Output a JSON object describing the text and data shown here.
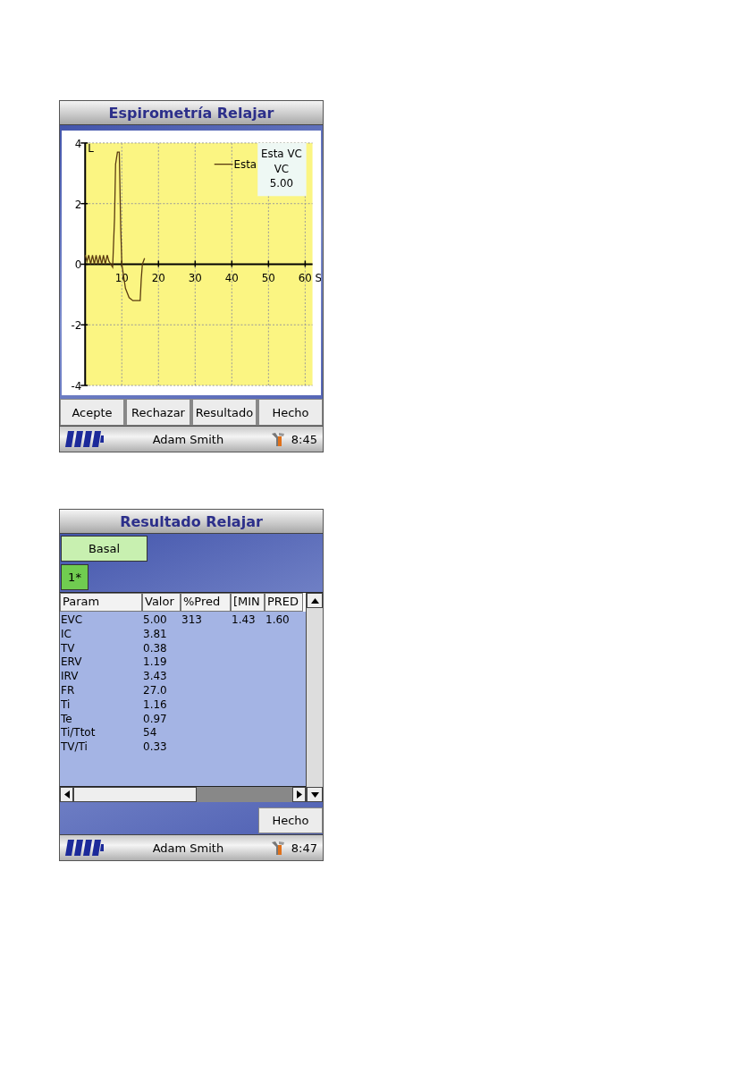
{
  "screens": [
    {
      "kind": "chart",
      "title": "Espirometría Relajar",
      "chart_data": {
        "type": "line",
        "grid": true,
        "xlabel": "S",
        "ylabel": "L",
        "xlim": [
          0,
          62
        ],
        "ylim": [
          -4,
          4
        ],
        "xticks": [
          10,
          20,
          30,
          40,
          50,
          60
        ],
        "yticks": [
          -4,
          -2,
          0,
          2,
          4
        ],
        "x": [
          0,
          0.5,
          1,
          1.5,
          2,
          2.5,
          3,
          3.5,
          4,
          4.5,
          5,
          5.5,
          6,
          6.5,
          7,
          7.5,
          8,
          8.3,
          8.8,
          9.3,
          9.7,
          10,
          11,
          12,
          13,
          14,
          15,
          15.3,
          15.6,
          16.2
        ],
        "series": [
          {
            "name": "Esta",
            "color": "#5a3a10",
            "values": [
              0.3,
              0.1,
              0.3,
              0,
              0.3,
              0,
              0.3,
              0,
              0.3,
              0,
              0.3,
              0,
              0.3,
              0.1,
              0,
              -0.1,
              1.5,
              3.3,
              3.7,
              3.7,
              1.2,
              0,
              -0.8,
              -1.1,
              -1.2,
              -1.2,
              -1.2,
              -0.5,
              0,
              0.2
            ]
          }
        ]
      },
      "readout": [
        "Esta VC",
        "VC",
        "5.00"
      ],
      "buttons": [
        "Acepte",
        "Rechazar",
        "Resultado",
        "Hecho"
      ],
      "status_bar": {
        "user": "Adam Smith",
        "time": "8:45"
      }
    },
    {
      "kind": "results",
      "title": "Resultado Relajar",
      "group_button": "Basal",
      "tests": [
        {
          "label": "1*",
          "selected": true
        }
      ],
      "table": {
        "columns": [
          "Param",
          "Valor",
          "%Pred",
          "[MIN",
          "PRED"
        ],
        "rows": [
          {
            "cells": [
              "EVC",
              "5.00",
              "313",
              "1.43",
              "1.60"
            ]
          },
          {
            "cells": [
              "IC",
              "3.81"
            ]
          },
          {
            "cells": [
              "TV",
              "0.38"
            ]
          },
          {
            "cells": [
              "ERV",
              "1.19"
            ]
          },
          {
            "cells": [
              "IRV",
              "3.43"
            ]
          },
          {
            "cells": [
              "FR",
              "27.0"
            ]
          },
          {
            "cells": [
              "Ti",
              "1.16"
            ]
          },
          {
            "cells": [
              "Te",
              "0.97"
            ]
          },
          {
            "cells": [
              "Ti/Ttot",
              "54"
            ]
          },
          {
            "cells": [
              "TV/Ti",
              "0.33"
            ]
          }
        ]
      },
      "buttons": [
        "Hecho"
      ],
      "status_bar": {
        "user": "Adam Smith",
        "time": "8:47"
      }
    }
  ]
}
